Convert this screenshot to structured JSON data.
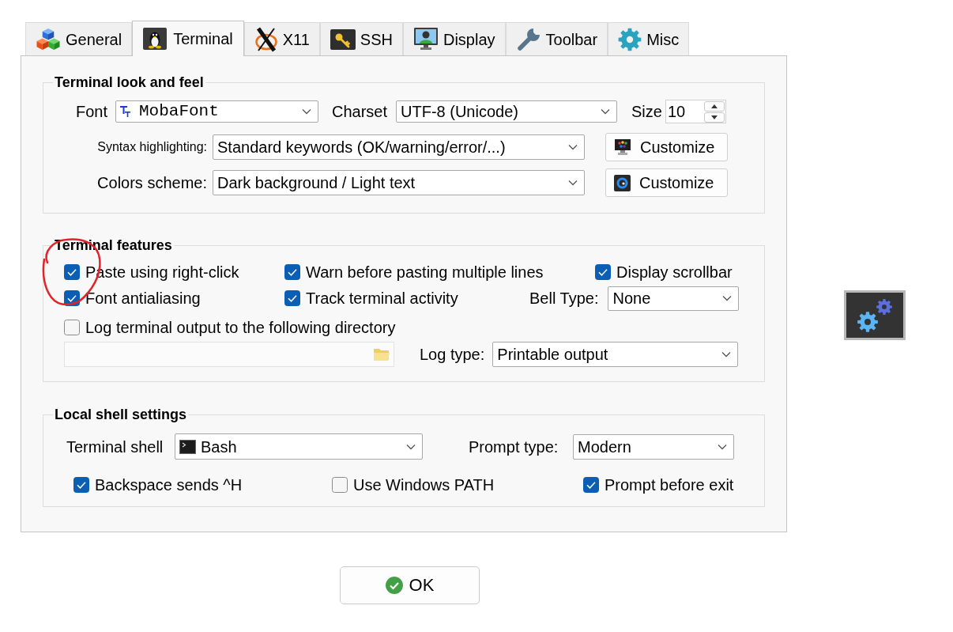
{
  "tabs": [
    {
      "label": "General",
      "selected": false
    },
    {
      "label": "Terminal",
      "selected": true
    },
    {
      "label": "X11",
      "selected": false
    },
    {
      "label": "SSH",
      "selected": false
    },
    {
      "label": "Display",
      "selected": false
    },
    {
      "label": "Toolbar",
      "selected": false
    },
    {
      "label": "Misc",
      "selected": false
    }
  ],
  "look_and_feel": {
    "title": "Terminal look and feel",
    "font": {
      "label": "Font",
      "value": "MobaFont"
    },
    "charset": {
      "label": "Charset",
      "value": "UTF-8 (Unicode)"
    },
    "size": {
      "label": "Size",
      "value": "10"
    },
    "syntax_highlighting": {
      "label": "Syntax highlighting:",
      "value": "Standard keywords (OK/warning/error/...)",
      "button": "Customize"
    },
    "colors_scheme": {
      "label": "Colors scheme:",
      "value": "Dark background / Light text",
      "button": "Customize"
    }
  },
  "features": {
    "title": "Terminal features",
    "options": [
      {
        "label": "Paste using right-click",
        "checked": true
      },
      {
        "label": "Warn before pasting multiple lines",
        "checked": true
      },
      {
        "label": "Display scrollbar",
        "checked": true
      },
      {
        "label": "Font antialiasing",
        "checked": true
      },
      {
        "label": "Track terminal activity",
        "checked": true
      }
    ],
    "bell_type": {
      "label": "Bell Type:",
      "value": "None"
    },
    "log_output": {
      "label": "Log terminal output to the following directory",
      "checked": false
    },
    "log_type": {
      "label": "Log type:",
      "value": "Printable output"
    }
  },
  "local_shell": {
    "title": "Local shell settings",
    "terminal_shell": {
      "label": "Terminal shell",
      "value": "Bash"
    },
    "prompt_type": {
      "label": "Prompt type:",
      "value": "Modern"
    },
    "options": [
      {
        "label": "Backspace sends ^H",
        "checked": true
      },
      {
        "label": "Use Windows PATH",
        "checked": false
      },
      {
        "label": "Prompt before exit",
        "checked": true
      }
    ]
  },
  "ok_button": {
    "label": "OK"
  }
}
